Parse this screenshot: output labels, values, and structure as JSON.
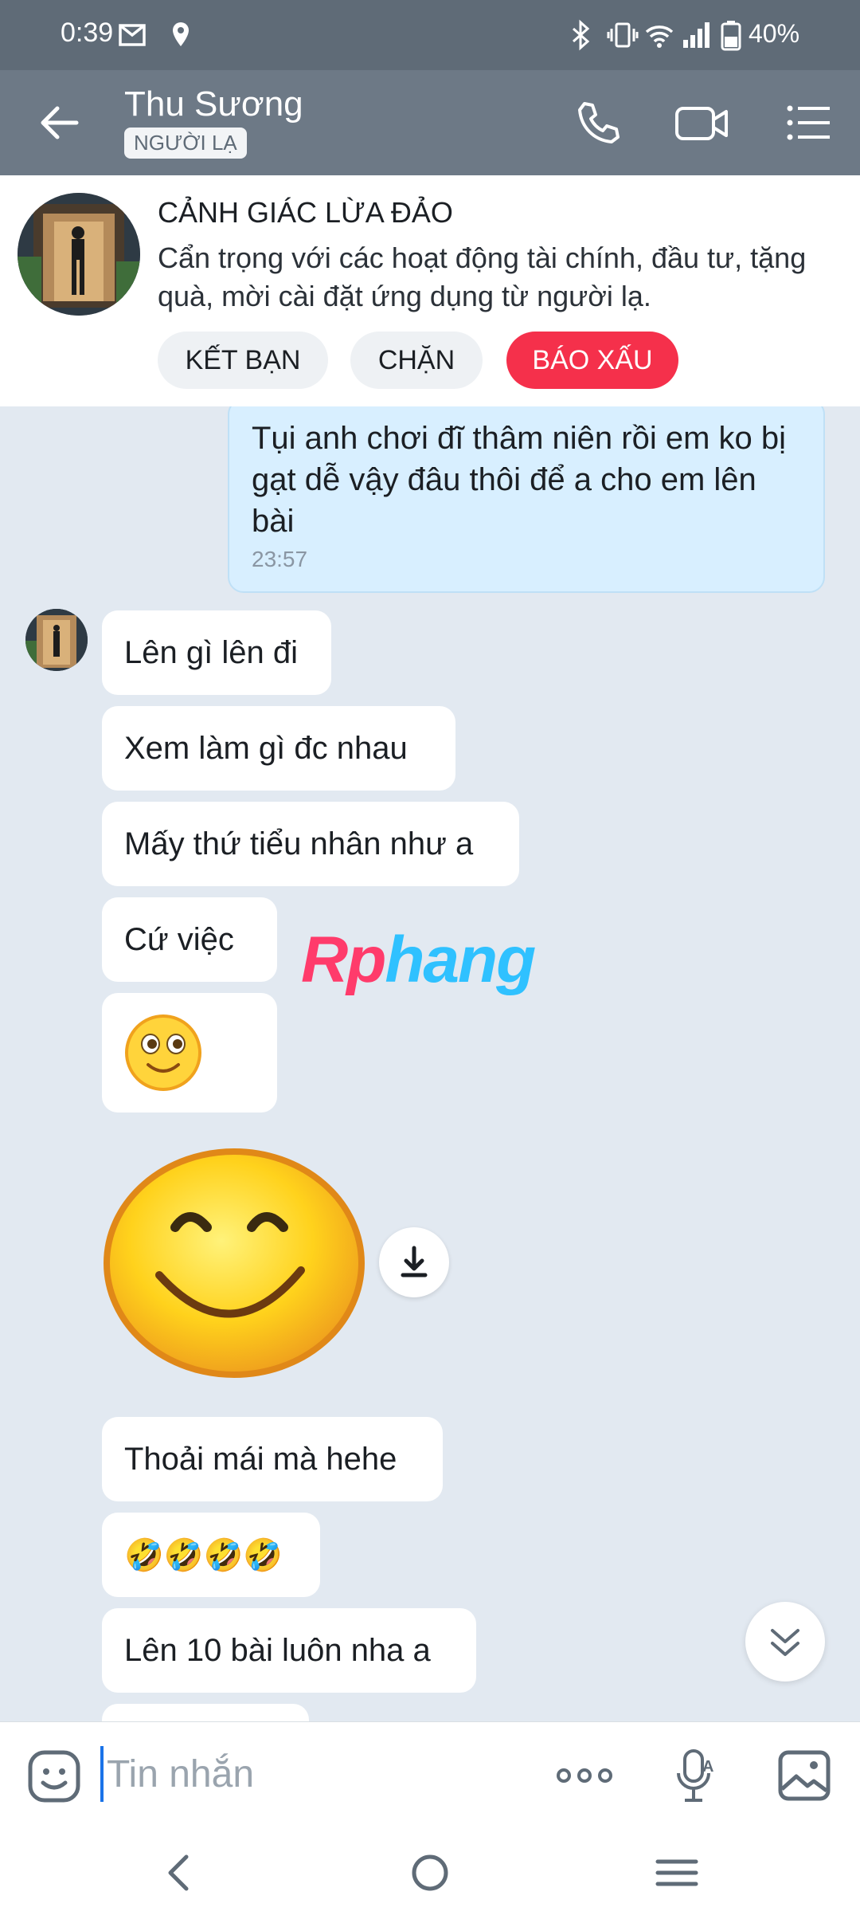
{
  "status_bar": {
    "time": "0:39",
    "battery": "40%"
  },
  "header": {
    "contact_name": "Thu Sương",
    "stranger_tag": "NGƯỜI LẠ"
  },
  "warning": {
    "title": "CẢNH GIÁC LỪA ĐẢO",
    "description": "Cẩn trọng với các hoạt động tài chính, đầu tư, tặng quà, mời cài đặt ứng dụng từ người lạ.",
    "add_friend": "KẾT BẠN",
    "block": "CHẶN",
    "report": "BÁO XẤU",
    "report_color": "#f5304b"
  },
  "messages": {
    "outgoing_text": "Tụi anh chơi đĩ thâm niên rồi em ko bị gạt dễ vậy đâu thôi để a cho em lên bài",
    "outgoing_time": "23:57",
    "m1": "Lên gì lên đi",
    "m2": "Xem làm gì đc nhau",
    "m3": "Mấy thứ tiểu nhân như a",
    "m4": "Cứ việc",
    "m6": "Thoải mái mà hehe",
    "m7": "🤣🤣🤣🤣",
    "m8": "Lên 10 bài luôn nha a"
  },
  "watermark": {
    "part1": "Rp",
    "part2": "hang"
  },
  "input": {
    "placeholder": "Tin nhắn"
  },
  "icons": {
    "back": "back-arrow-icon",
    "call": "phone-icon",
    "video": "video-call-icon",
    "menu": "menu-list-icon",
    "download": "download-icon",
    "scroll": "double-chevron-down-icon"
  }
}
